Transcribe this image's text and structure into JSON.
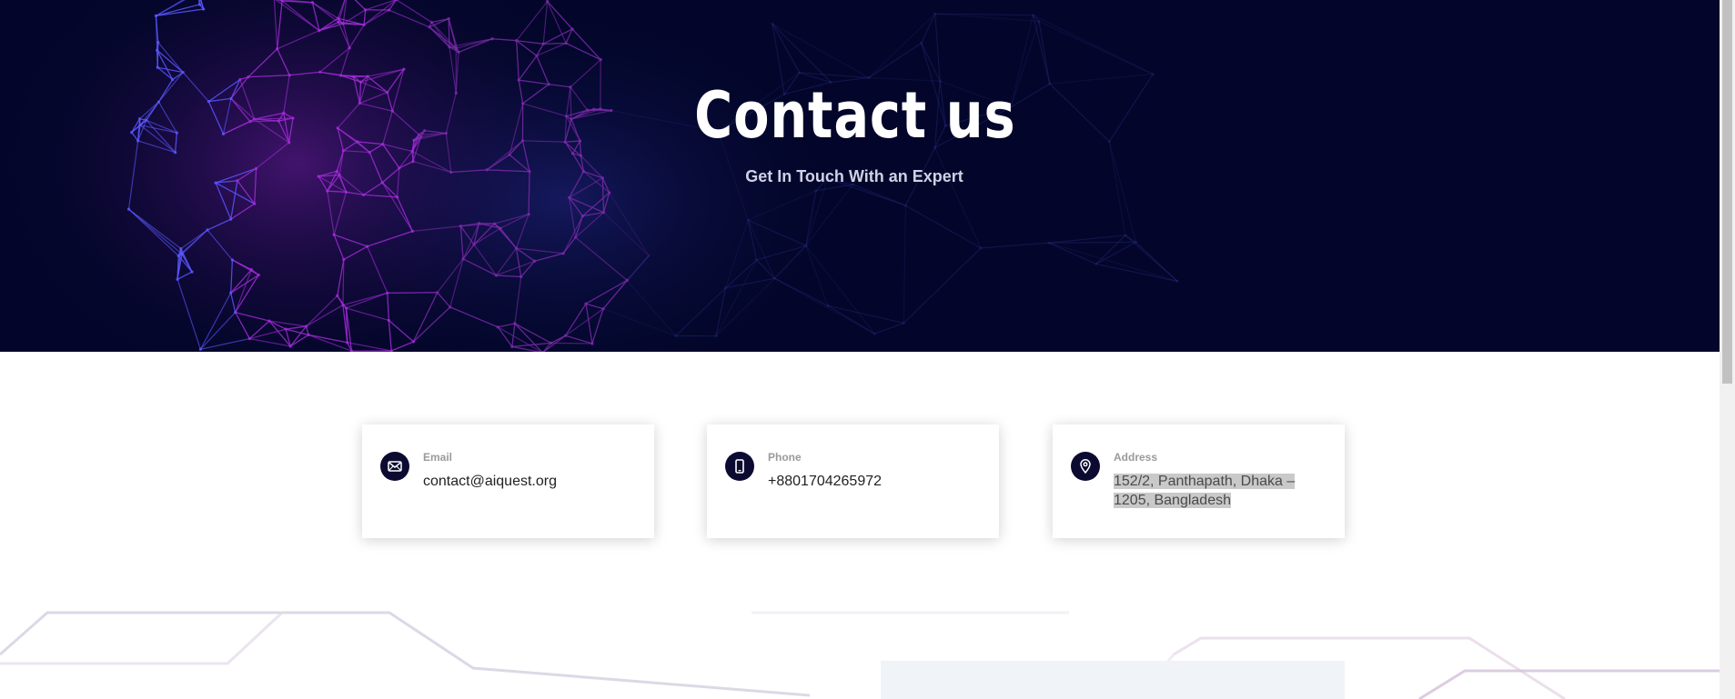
{
  "hero": {
    "title": "Contact us",
    "subtitle": "Get In Touch With an Expert"
  },
  "contact_cards": [
    {
      "label": "Email",
      "value": "contact@aiquest.org",
      "icon": "envelope-icon"
    },
    {
      "label": "Phone",
      "value": "+8801704265972",
      "icon": "mobile-phone-icon"
    },
    {
      "label": "Address",
      "value": "152/2, Panthapath, Dhaka – 1205, Bangladesh",
      "icon": "map-pin-icon"
    }
  ],
  "colors": {
    "hero_background": "#03062a",
    "icon_circle": "#0b0b32",
    "accent_magenta": "#b428c8",
    "accent_blue": "#4b5cff"
  }
}
